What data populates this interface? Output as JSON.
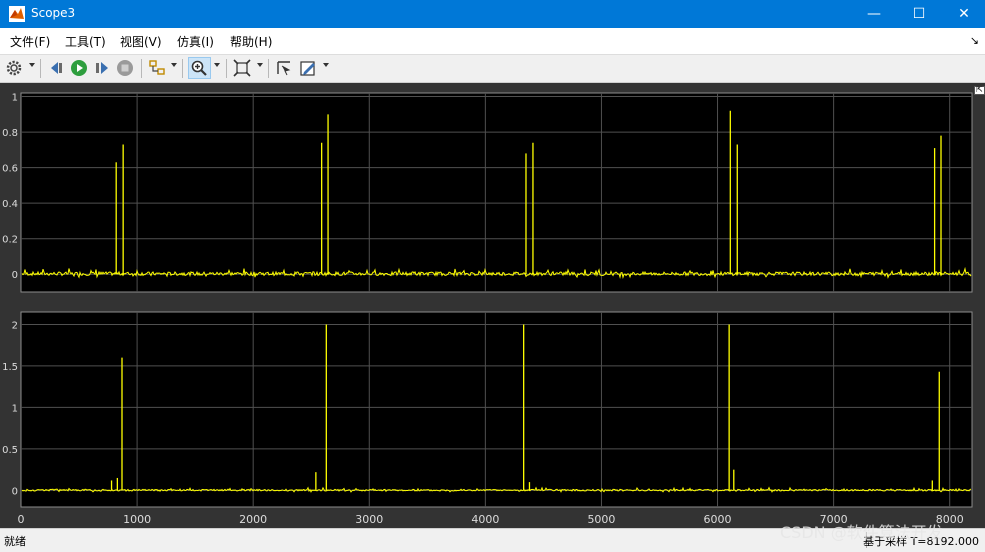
{
  "window": {
    "title": "Scope3",
    "minimize": "—",
    "maximize": "☐",
    "close": "✕"
  },
  "menu": [
    "文件(F)",
    "工具(T)",
    "视图(V)",
    "仿真(I)",
    "帮助(H)"
  ],
  "toolbar": {
    "icons": [
      "gear-icon",
      "step-back-icon",
      "run-icon",
      "step-forward-icon",
      "stop-icon",
      "signal-select-icon",
      "zoom-in-icon",
      "fit-to-view-icon",
      "cursor-measure-icon",
      "style-edit-icon"
    ]
  },
  "chart_data": [
    {
      "type": "line",
      "ylim": [
        -0.1,
        1.02
      ],
      "xlim": [
        0,
        8192
      ],
      "yticks": [
        0,
        0.2,
        0.4,
        0.6,
        0.8,
        1
      ],
      "ytick_labels": [
        "0",
        "0.2",
        "0.4",
        "0.6",
        "0.8",
        "1"
      ],
      "grid": true,
      "series_color": "#ffff00",
      "noise_level": 0.02,
      "spikes": [
        {
          "x": 820,
          "y": 0.63
        },
        {
          "x": 880,
          "y": 0.73
        },
        {
          "x": 2590,
          "y": 0.74
        },
        {
          "x": 2645,
          "y": 0.9
        },
        {
          "x": 4350,
          "y": 0.68
        },
        {
          "x": 4410,
          "y": 0.74
        },
        {
          "x": 6110,
          "y": 0.92
        },
        {
          "x": 6170,
          "y": 0.73
        },
        {
          "x": 7870,
          "y": 0.71
        },
        {
          "x": 7925,
          "y": 0.78
        }
      ]
    },
    {
      "type": "line",
      "ylim": [
        -0.2,
        2.15
      ],
      "xlim": [
        0,
        8192
      ],
      "yticks": [
        0,
        0.5,
        1,
        1.5,
        2
      ],
      "ytick_labels": [
        "0",
        "0.5",
        "1",
        "1.5",
        "2"
      ],
      "xticks": [
        0,
        1000,
        2000,
        3000,
        4000,
        5000,
        6000,
        7000,
        8000
      ],
      "xtick_labels": [
        "0",
        "1000",
        "2000",
        "3000",
        "4000",
        "5000",
        "6000",
        "7000",
        "8000"
      ],
      "grid": true,
      "series_color": "#ffff00",
      "noise_level": 0.02,
      "spikes": [
        {
          "x": 780,
          "y": 0.12
        },
        {
          "x": 830,
          "y": 0.15
        },
        {
          "x": 870,
          "y": 1.6
        },
        {
          "x": 2540,
          "y": 0.22
        },
        {
          "x": 2630,
          "y": 2.0
        },
        {
          "x": 4330,
          "y": 2.0
        },
        {
          "x": 4380,
          "y": 0.1
        },
        {
          "x": 6100,
          "y": 2.0
        },
        {
          "x": 6140,
          "y": 0.25
        },
        {
          "x": 7850,
          "y": 0.12
        },
        {
          "x": 7910,
          "y": 1.43
        }
      ]
    }
  ],
  "status": {
    "left": "就绪",
    "right": "基于采样 T=8192.000"
  },
  "watermark": "CSDN @软件算法开发"
}
